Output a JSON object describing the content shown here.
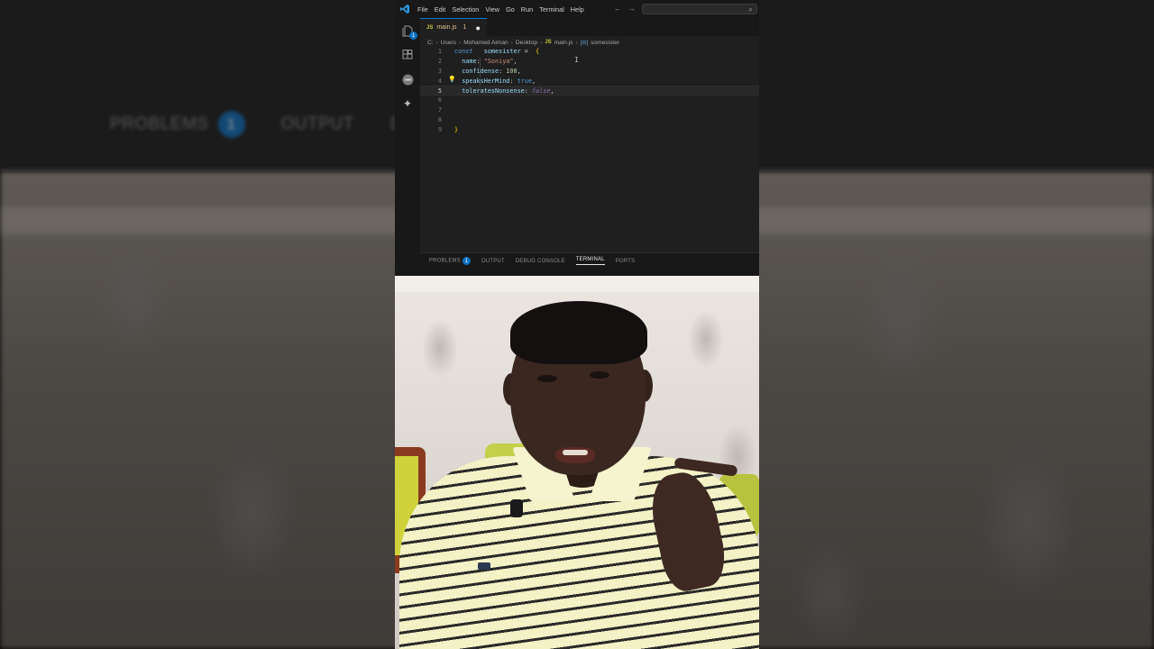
{
  "background": {
    "panel_tabs": [
      {
        "label": "PROBLEMS",
        "badge": "1"
      },
      {
        "label": "OUTPUT"
      },
      {
        "label": "DE"
      }
    ]
  },
  "menu": [
    "File",
    "Edit",
    "Selection",
    "View",
    "Go",
    "Run",
    "Terminal",
    "Help"
  ],
  "activity_icons": [
    "explorer-icon",
    "extensions-icon",
    "accounts-icon",
    "copilot-icon"
  ],
  "explorer_badge": "1",
  "tab": {
    "icon": "JS",
    "name": "main.js",
    "problems": "1",
    "modified_dot": "●"
  },
  "breadcrumb": [
    "C:",
    "Users",
    "Mohamed Aiman",
    "Desktop",
    "main.js",
    "somesister"
  ],
  "breadcrumb_file_icon": "JS",
  "editor": {
    "line_numbers": [
      "1",
      "2",
      "3",
      "4",
      "5",
      "6",
      "7",
      "8",
      "9"
    ],
    "current_line": 5,
    "lines": {
      "l1_kw": "const",
      "l1_var": "somesister",
      "l1_op": " = ",
      "l1_brace": "{",
      "l2_prop": "name",
      "l2_str": "\"Soniya\"",
      "l3_prop": "confidense",
      "l3_num": "100",
      "l4_prop": "speaksHerMind",
      "l4_bool": "true",
      "l5_prop": "toleratesNonsense",
      "l5_bool": "false",
      "l9_brace": "}"
    }
  },
  "panel": {
    "tabs": [
      "PROBLEMS",
      "OUTPUT",
      "DEBUG CONSOLE",
      "TERMINAL",
      "PORTS"
    ],
    "problems_badge": "1",
    "active": "TERMINAL"
  },
  "colors": {
    "accent": "#0078d4",
    "badge": "#0e70c0",
    "editor_bg": "#1f1f1f"
  }
}
